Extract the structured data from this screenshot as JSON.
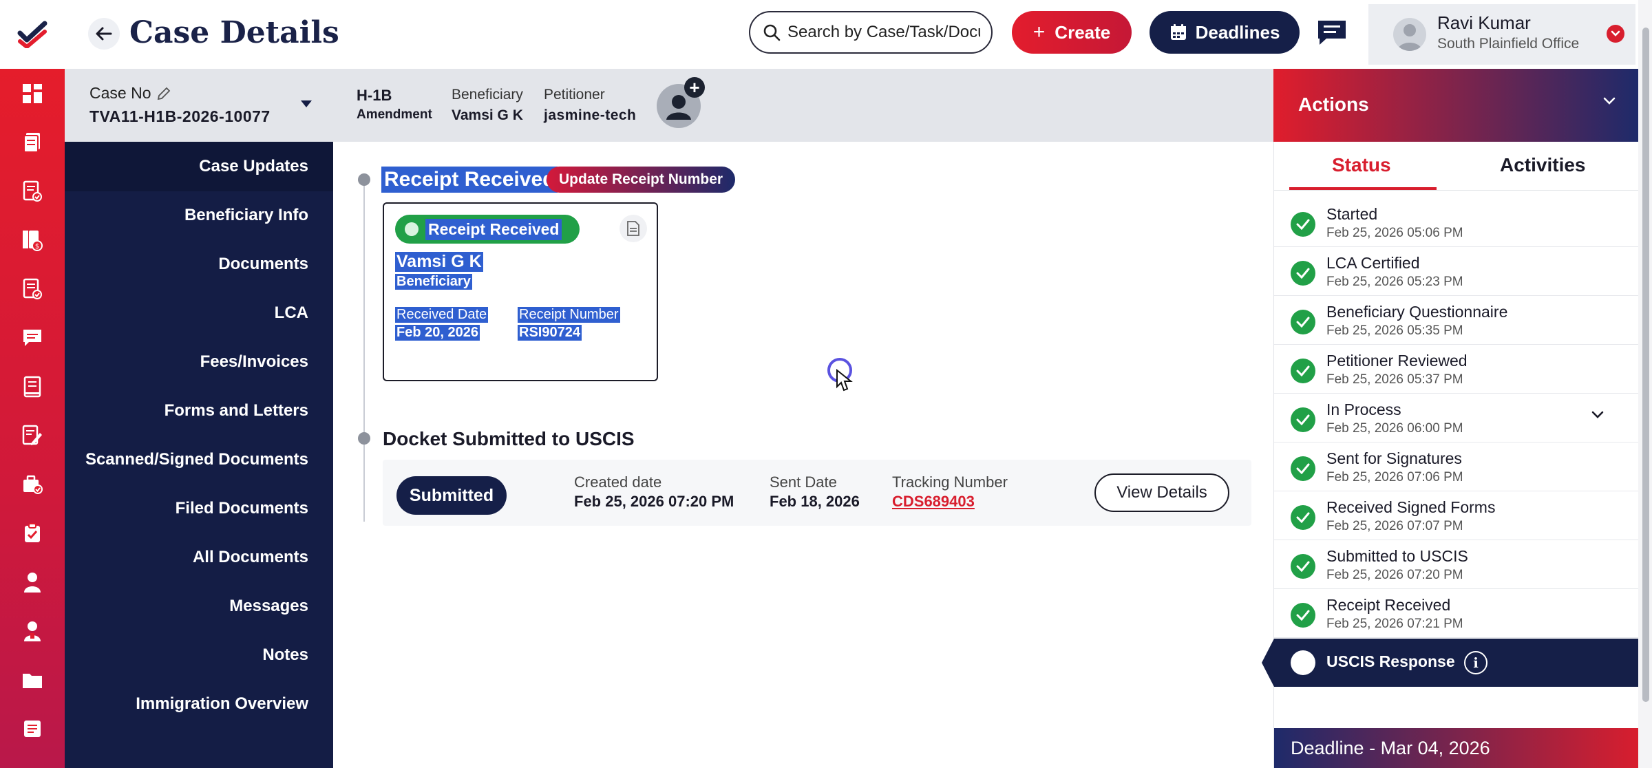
{
  "header": {
    "title": "Case Details",
    "search_placeholder": "Search by Case/Task/Document",
    "create_label": "Create",
    "deadlines_label": "Deadlines",
    "user_name": "Ravi Kumar",
    "user_office": "South Plainfield Office"
  },
  "case": {
    "case_no_label": "Case No",
    "case_no": "TVA11-H1B-2026-10077",
    "visa_type": "H-1B",
    "visa_subtype": "Amendment",
    "beneficiary_label": "Beneficiary",
    "beneficiary": "Vamsi G K",
    "petitioner_label": "Petitioner",
    "petitioner": "jasmine-tech"
  },
  "nav": {
    "items": [
      "Case Updates",
      "Beneficiary Info",
      "Documents",
      "LCA",
      "Fees/Invoices",
      "Forms and Letters",
      "Scanned/Signed Documents",
      "Filed Documents",
      "All Documents",
      "Messages",
      "Notes",
      "Immigration Overview"
    ]
  },
  "main": {
    "receipt_section_title": "Receipt Received",
    "update_receipt_label": "Update Receipt Number",
    "receipt_card": {
      "status": "Receipt Received",
      "name": "Vamsi G K",
      "role": "Beneficiary",
      "received_date_label": "Received Date",
      "received_date": "Feb 20, 2026",
      "receipt_number_label": "Receipt Number",
      "receipt_number": "RSI90724"
    },
    "docket_section_title": "Docket Submitted to USCIS",
    "docket": {
      "status": "Submitted",
      "created_label": "Created date",
      "created_value": "Feb 25, 2026 07:20 PM",
      "sent_label": "Sent Date",
      "sent_value": "Feb 18, 2026",
      "tracking_label": "Tracking Number",
      "tracking_value": "CDS689403",
      "view_details_label": "View Details"
    }
  },
  "actions": {
    "title": "Actions",
    "tab_status": "Status",
    "tab_activities": "Activities",
    "statuses": [
      {
        "name": "Started",
        "date": "Feb 25, 2026 05:06 PM"
      },
      {
        "name": "LCA Certified",
        "date": "Feb 25, 2026 05:23 PM"
      },
      {
        "name": "Beneficiary Questionnaire",
        "date": "Feb 25, 2026 05:35 PM"
      },
      {
        "name": "Petitioner Reviewed",
        "date": "Feb 25, 2026 05:37 PM"
      },
      {
        "name": "In Process",
        "date": "Feb 25, 2026 06:00 PM"
      },
      {
        "name": "Sent for Signatures",
        "date": "Feb 25, 2026 07:06 PM"
      },
      {
        "name": "Received Signed Forms",
        "date": "Feb 25, 2026 07:07 PM"
      },
      {
        "name": "Submitted to USCIS",
        "date": "Feb 25, 2026 07:20 PM"
      },
      {
        "name": "Receipt Received",
        "date": "Feb 25, 2026 07:21 PM"
      }
    ],
    "pending_status": "USCIS Response",
    "deadline": "Deadline - Mar 04, 2026"
  },
  "colors": {
    "brand_red": "#e31d2d",
    "brand_navy": "#151f48",
    "success_green": "#21a047",
    "selection_blue": "#2f5fd0"
  }
}
